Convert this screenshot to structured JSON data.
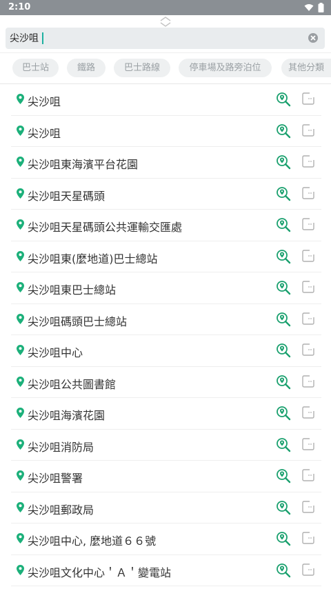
{
  "status": {
    "time": "2:10"
  },
  "search": {
    "value": "尖沙咀",
    "placeholder": ""
  },
  "chips": [
    {
      "label": "巴士站"
    },
    {
      "label": "鐵路"
    },
    {
      "label": "巴士路線"
    },
    {
      "label": "停車場及路旁泊位"
    },
    {
      "label": "其他分類"
    }
  ],
  "results": [
    {
      "label": "尖沙咀"
    },
    {
      "label": "尖沙咀"
    },
    {
      "label": "尖沙咀東海濱平台花園"
    },
    {
      "label": "尖沙咀天星碼頭"
    },
    {
      "label": "尖沙咀天星碼頭公共運輸交匯處"
    },
    {
      "label": "尖沙咀東(麼地道)巴士總站"
    },
    {
      "label": "尖沙咀東巴士總站"
    },
    {
      "label": "尖沙咀碼頭巴士總站"
    },
    {
      "label": "尖沙咀中心"
    },
    {
      "label": "尖沙咀公共圖書館"
    },
    {
      "label": "尖沙咀海濱花園"
    },
    {
      "label": "尖沙咀消防局"
    },
    {
      "label": "尖沙咀警署"
    },
    {
      "label": "尖沙咀郵政局"
    },
    {
      "label": "尖沙咀中心, 麼地道６６號"
    },
    {
      "label": "尖沙咀文化中心＇Ａ＇變電站"
    }
  ],
  "colors": {
    "accent": "#1cb07a",
    "chip_bg": "#eef0f1",
    "chip_text": "#9aa0a4"
  },
  "icons": {
    "pin": "map-pin-icon",
    "zoom": "zoom-in-map-icon",
    "action": "square-action-icon"
  }
}
